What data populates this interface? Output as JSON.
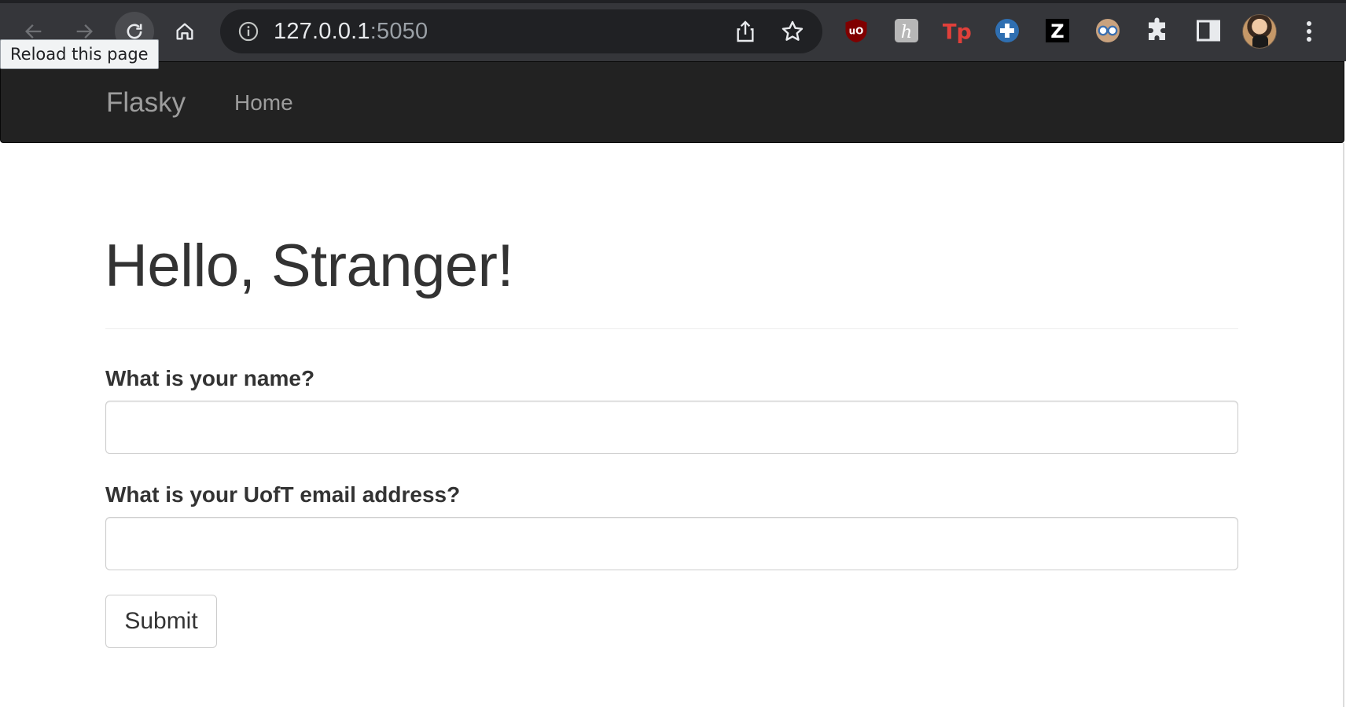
{
  "browser": {
    "url_host": "127.0.0.1",
    "url_port": ":5050",
    "tooltip": "Reload this page",
    "icons": [
      "back-icon",
      "forward-icon",
      "reload-icon",
      "home-icon",
      "info-icon",
      "share-icon",
      "star-icon",
      "ublock-icon",
      "honey-icon",
      "tp-icon",
      "plus-ext-icon",
      "z-ext-icon",
      "glasses-ext-icon",
      "extensions-icon",
      "sidepanel-icon",
      "avatar",
      "menu-icon"
    ]
  },
  "navbar": {
    "brand": "Flasky",
    "items": [
      {
        "label": "Home"
      }
    ]
  },
  "main": {
    "title": "Hello, Stranger!",
    "form": {
      "name_label": "What is your name?",
      "name_value": "",
      "email_label": "What is your UofT email address?",
      "email_value": "",
      "submit_label": "Submit"
    }
  },
  "colors": {
    "navbar_bg": "#222222",
    "navbar_text": "#9d9d9d",
    "text": "#333333",
    "browser_toolbar": "#35363a",
    "omnibox": "#202124"
  }
}
